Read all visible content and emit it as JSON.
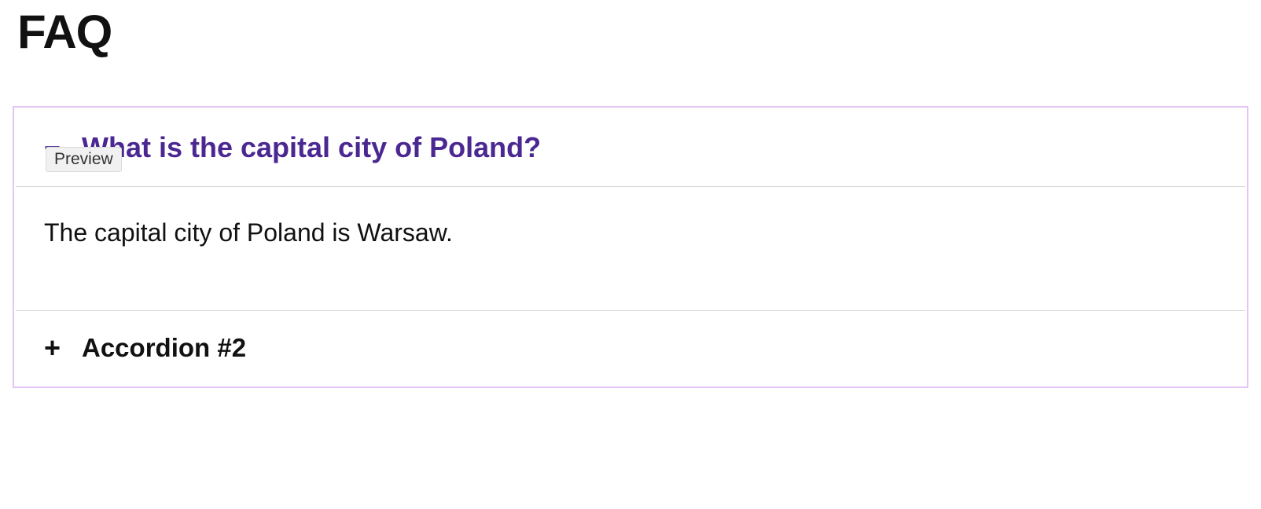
{
  "page": {
    "title": "FAQ"
  },
  "badge": {
    "label": "Preview"
  },
  "accordion": {
    "items": [
      {
        "expanded": true,
        "icon": "−",
        "title": "What is the capital city of Poland?",
        "body": "The capital city of Poland is Warsaw."
      },
      {
        "expanded": false,
        "icon": "+",
        "title": "Accordion #2"
      }
    ]
  }
}
